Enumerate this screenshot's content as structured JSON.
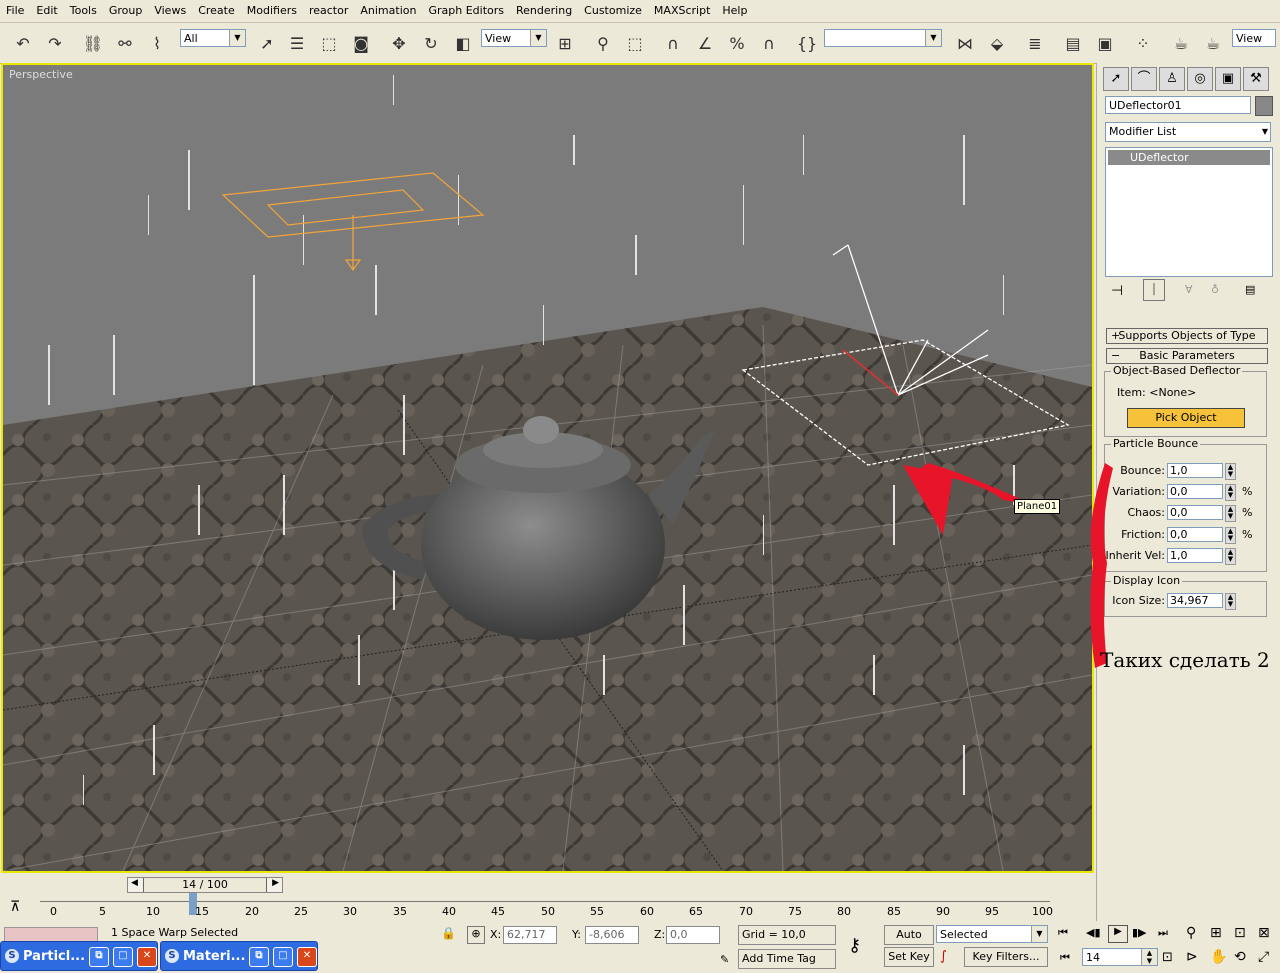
{
  "menu": [
    "File",
    "Edit",
    "Tools",
    "Group",
    "Views",
    "Create",
    "Modifiers",
    "reactor",
    "Animation",
    "Graph Editors",
    "Rendering",
    "Customize",
    "MAXScript",
    "Help"
  ],
  "toolbar": {
    "selection_filter": "All",
    "ref_coord": "View",
    "named_selection": "",
    "render_view": "View"
  },
  "viewport": {
    "label": "Perspective",
    "tooltip": "Plane01"
  },
  "command_panel": {
    "object_name": "UDeflector01",
    "modifier_list": "Modifier List",
    "stack_item": "UDeflector",
    "rollout_supports": "Supports Objects of Type",
    "rollout_basic": "Basic Parameters",
    "group_object": "Object-Based Deflector",
    "item_label": "Item: <None>",
    "pick_button": "Pick Object",
    "group_bounce": "Particle Bounce",
    "bounce": {
      "label": "Bounce:",
      "value": "1,0"
    },
    "variation": {
      "label": "Variation:",
      "value": "0,0",
      "unit": "%"
    },
    "chaos": {
      "label": "Chaos:",
      "value": "0,0",
      "unit": "%"
    },
    "friction": {
      "label": "Friction:",
      "value": "0,0",
      "unit": "%"
    },
    "inherit": {
      "label": "Inherit Vel:",
      "value": "1,0"
    },
    "group_display": "Display Icon",
    "icon_size": {
      "label": "Icon Size:",
      "value": "34,967"
    },
    "annotation": "Таких сделать 2"
  },
  "timeline": {
    "slider_text": "14 / 100",
    "ticks": [
      "0",
      "5",
      "10",
      "15",
      "20",
      "25",
      "30",
      "35",
      "40",
      "45",
      "50",
      "55",
      "60",
      "65",
      "70",
      "75",
      "80",
      "85",
      "90",
      "95",
      "100"
    ]
  },
  "status": {
    "selection": "1 Space Warp Selected",
    "x_label": "X:",
    "x_value": "62,717",
    "y_label": "Y:",
    "y_value": "-8,606",
    "z_label": "Z:",
    "z_value": "0,0",
    "grid": "Grid = 10,0",
    "add_time_tag": "Add Time Tag",
    "auto_key": "Auto Key",
    "set_key": "Set Key",
    "key_mode": "Selected",
    "key_filters": "Key Filters...",
    "frame": "14"
  },
  "taskbar": [
    {
      "title": "Particl..."
    },
    {
      "title": "Materi..."
    }
  ]
}
